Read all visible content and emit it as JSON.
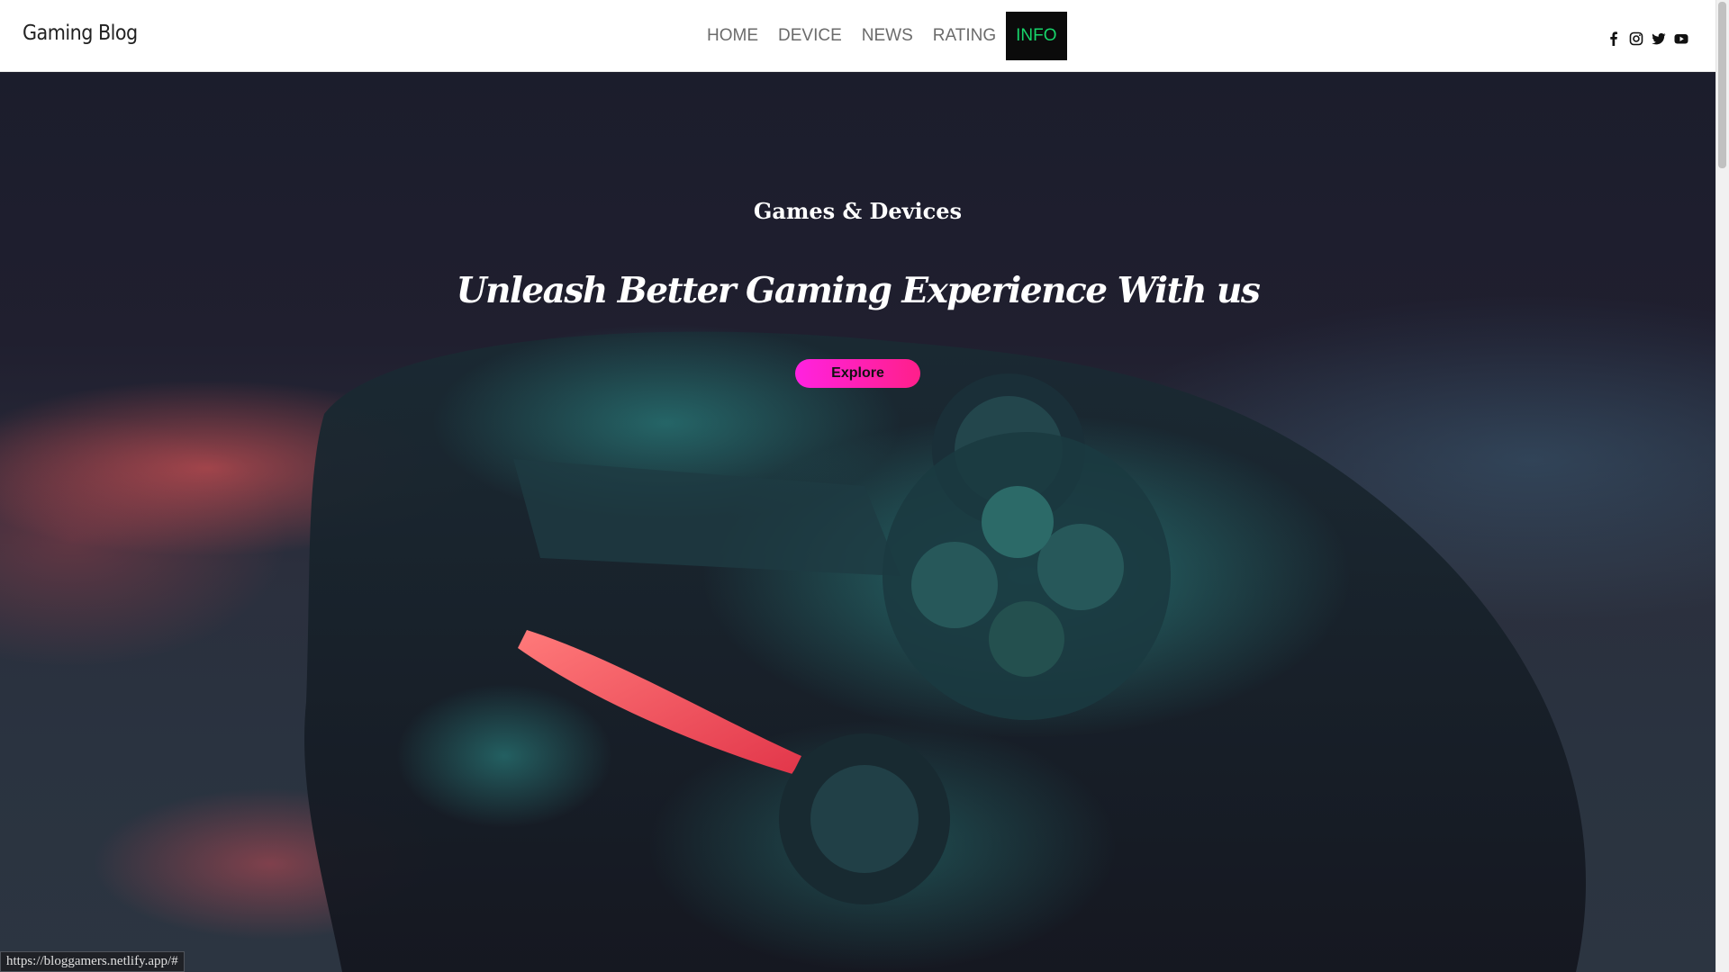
{
  "brand": {
    "name": "Gaming Blog"
  },
  "nav": {
    "items": [
      {
        "label": "HOME"
      },
      {
        "label": "DEVICE"
      },
      {
        "label": "NEWS"
      },
      {
        "label": "RATING"
      },
      {
        "label": "INFO",
        "active": true
      }
    ],
    "active_color": "#17d46a"
  },
  "socials": [
    "facebook-icon",
    "instagram-icon",
    "twitter-icon",
    "youtube-icon"
  ],
  "hero": {
    "kicker": "Games & Devices",
    "title": "Unleash Better Gaming Experience With us",
    "cta_label": "Explore",
    "cta_gradient": [
      "#ff22e0",
      "#ff1f8a"
    ],
    "background_subject": "game-controller-photo"
  },
  "status_bar": {
    "url": "https://bloggamers.netlify.app/#"
  }
}
